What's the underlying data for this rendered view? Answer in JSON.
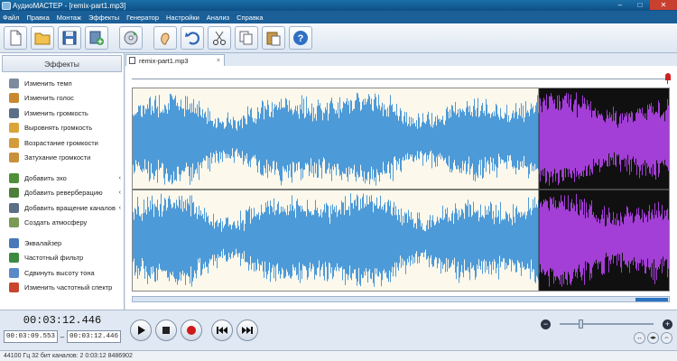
{
  "window": {
    "title": "АудиоМАСТЕР - [remix-part1.mp3]",
    "minimize": "–",
    "maximize": "□",
    "close": "✕"
  },
  "menu": [
    "Файл",
    "Правка",
    "Монтаж",
    "Эффекты",
    "Генератор",
    "Настройки",
    "Анализ",
    "Справка"
  ],
  "toolbar": {
    "buttons": [
      "new-file-icon",
      "open-folder-icon",
      "save-icon",
      "add-file-icon",
      "record-cd-icon",
      "ear-icon",
      "undo-icon",
      "cut-icon",
      "copy-icon",
      "paste-icon",
      "help-icon"
    ]
  },
  "effects_panel": {
    "header": "Эффекты",
    "groups": [
      [
        {
          "label": "Изменить темп",
          "icon": "tempo-icon",
          "color": "#7d8b9c",
          "arrow": ""
        },
        {
          "label": "Изменить голос",
          "icon": "voice-icon",
          "color": "#c9872f",
          "arrow": ""
        },
        {
          "label": "Изменить громкость",
          "icon": "volume-icon",
          "color": "#5c6f86",
          "arrow": ""
        },
        {
          "label": "Выровнять громкость",
          "icon": "level-icon",
          "color": "#d9a43a",
          "arrow": ""
        },
        {
          "label": "Возрастание громкости",
          "icon": "fade-in-icon",
          "color": "#d39b3a",
          "arrow": ""
        },
        {
          "label": "Затухание громкости",
          "icon": "fade-out-icon",
          "color": "#c8903a",
          "arrow": ""
        }
      ],
      [
        {
          "label": "Добавить эхо",
          "icon": "echo-icon",
          "color": "#4f8f3a",
          "arrow": "‹"
        },
        {
          "label": "Добавить реверберацию",
          "icon": "reverb-icon",
          "color": "#4e7f3a",
          "arrow": "‹"
        },
        {
          "label": "Добавить вращение каналов",
          "icon": "rotate-icon",
          "color": "#5c6f86",
          "arrow": "‹"
        },
        {
          "label": "Создать атмосферу",
          "icon": "atmosphere-icon",
          "color": "#7a9a56",
          "arrow": ""
        }
      ],
      [
        {
          "label": "Эквалайзер",
          "icon": "equalizer-icon",
          "color": "#4a78b8",
          "arrow": ""
        },
        {
          "label": "Частотный фильтр",
          "icon": "filter-icon",
          "color": "#3b8a3f",
          "arrow": ""
        },
        {
          "label": "Сдвинуть высоту тона",
          "icon": "pitch-icon",
          "color": "#5a8ac8",
          "arrow": ""
        },
        {
          "label": "Изменить частотный спектр",
          "icon": "spectrum-icon",
          "color": "#c8452f",
          "arrow": ""
        }
      ]
    ]
  },
  "tab": {
    "label": "remix-part1.mp3",
    "close": "×"
  },
  "waveform": {
    "played_color": "#4d9ad8",
    "played_bg": "#fdf8ec",
    "unplayed_color": "#a33ed6",
    "unplayed_bg": "#101010",
    "split_fraction": 0.757
  },
  "timer": {
    "current": "00:03:12.446",
    "start": "00:03:09.553",
    "separator": "–",
    "end": "00:03:12.446"
  },
  "zoom": {
    "minus": "−",
    "plus": "+",
    "level": 0.2
  },
  "status": "44100 Гц  32 бит  каналов: 2   0:03:12  8486902"
}
